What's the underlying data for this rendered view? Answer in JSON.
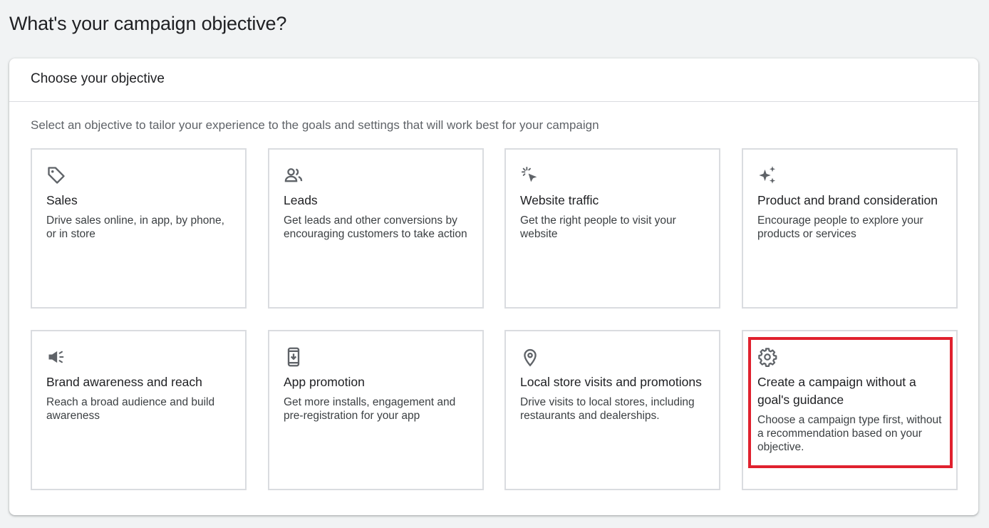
{
  "page": {
    "title": "What's your campaign objective?"
  },
  "panel": {
    "header": "Choose your objective",
    "subtitle": "Select an objective to tailor your experience to the goals and settings that will work best for your campaign"
  },
  "objectives": [
    {
      "icon": "tag-icon",
      "title": "Sales",
      "description": "Drive sales online, in app, by phone, or in store"
    },
    {
      "icon": "people-icon",
      "title": "Leads",
      "description": "Get leads and other conversions by encouraging customers to take action"
    },
    {
      "icon": "cursor-click-icon",
      "title": "Website traffic",
      "description": "Get the right people to visit your website"
    },
    {
      "icon": "sparkle-icon",
      "title": "Product and brand consideration",
      "description": "Encourage people to explore your products or services"
    },
    {
      "icon": "megaphone-icon",
      "title": "Brand awareness and reach",
      "description": "Reach a broad audience and build awareness"
    },
    {
      "icon": "phone-download-icon",
      "title": "App promotion",
      "description": "Get more installs, engagement and pre-registration for your app"
    },
    {
      "icon": "location-pin-icon",
      "title": "Local store visits and promotions",
      "description": "Drive visits to local stores, including restaurants and dealerships."
    },
    {
      "icon": "gear-icon",
      "title": "Create a campaign without a goal's guidance",
      "description": "Choose a campaign type first, without a recommendation based on your objective."
    }
  ],
  "colors": {
    "background": "#f1f3f4",
    "icon": "#5f6368",
    "highlight": "#e0212e",
    "border": "#dadce0"
  }
}
